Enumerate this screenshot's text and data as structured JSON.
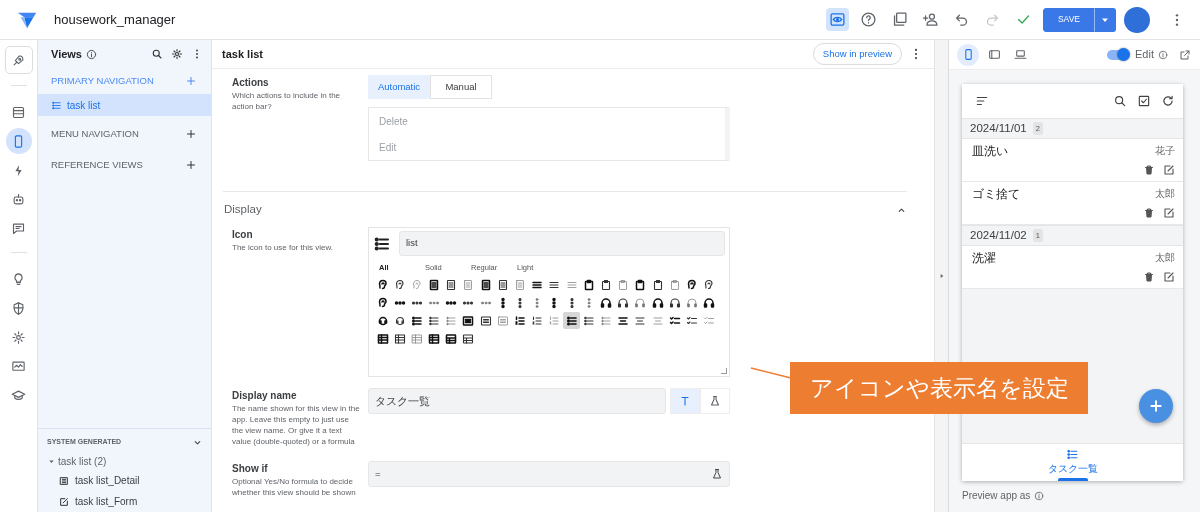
{
  "app": {
    "title": "housework_manager"
  },
  "tools": [
    {
      "selected": true,
      "disabled": false
    },
    {
      "selected": false,
      "disabled": false
    },
    {
      "selected": false,
      "disabled": false
    },
    {
      "selected": false,
      "disabled": false
    },
    {
      "selected": false,
      "disabled": false
    },
    {
      "selected": false,
      "disabled": true
    },
    {
      "selected": false,
      "disabled": false
    }
  ],
  "save_button": {
    "label": "SAVE"
  },
  "rail": [
    {
      "selected": false
    },
    {
      "selected": false
    },
    {
      "selected": true
    },
    {
      "selected": false
    },
    {
      "selected": false
    },
    {
      "selected": false
    },
    {
      "selected": false
    },
    {
      "selected": false
    },
    {
      "selected": false
    },
    {
      "selected": false
    },
    {
      "selected": false
    }
  ],
  "views_panel": {
    "title": "Views",
    "sections": [
      {
        "label": "PRIMARY NAVIGATION",
        "items": [
          {
            "label": "task list",
            "selected": true
          }
        ]
      },
      {
        "label": "MENU NAVIGATION"
      },
      {
        "label": "REFERENCE VIEWS"
      }
    ],
    "system_generated": {
      "label": "SYSTEM GENERATED",
      "expanded": true,
      "groups": [
        {
          "label": "task list (2)",
          "expanded": true,
          "children": [
            {
              "label": "task list_Detail",
              "kind": "detail"
            },
            {
              "label": "task list_Form",
              "kind": "form"
            }
          ]
        }
      ]
    }
  },
  "editor": {
    "title": "task list",
    "preview_button": "Show in preview",
    "actions": {
      "label": "Actions",
      "help": "Which actions to include in the action bar?",
      "modes": [
        {
          "label": "Automatic",
          "selected": true
        },
        {
          "label": "Manual",
          "selected": false
        }
      ],
      "items": [
        "Delete",
        "Edit"
      ]
    },
    "display": {
      "title": "Display",
      "expanded": true,
      "icon": {
        "label": "Icon",
        "help": "The icon to use for this view.",
        "value": "list",
        "filters": [
          {
            "label": "All",
            "selected": true
          },
          {
            "label": "Solid",
            "selected": false
          },
          {
            "label": "Regular",
            "selected": false
          },
          {
            "label": "Light",
            "selected": false
          }
        ],
        "options": [
          {
            "selected": false
          },
          {
            "selected": false
          },
          {
            "selected": false
          },
          {
            "selected": false
          },
          {
            "selected": false
          },
          {
            "selected": false
          },
          {
            "selected": false
          },
          {
            "selected": false
          },
          {
            "selected": false
          },
          {
            "selected": false
          },
          {
            "selected": false
          },
          {
            "selected": false
          },
          {
            "selected": false
          },
          {
            "selected": false
          },
          {
            "selected": false
          },
          {
            "selected": false
          },
          {
            "selected": false
          },
          {
            "selected": false
          },
          {
            "selected": false
          },
          {
            "selected": false
          },
          {
            "selected": false
          },
          {
            "selected": false
          },
          {
            "selected": false
          },
          {
            "selected": false
          },
          {
            "selected": false
          },
          {
            "selected": false
          },
          {
            "selected": false
          },
          {
            "selected": false
          },
          {
            "selected": false
          },
          {
            "selected": false
          },
          {
            "selected": false
          },
          {
            "selected": false
          },
          {
            "selected": false
          },
          {
            "selected": false
          },
          {
            "selected": false
          },
          {
            "selected": false
          },
          {
            "selected": false
          },
          {
            "selected": false
          },
          {
            "selected": false
          },
          {
            "selected": false
          },
          {
            "selected": false
          },
          {
            "selected": false
          },
          {
            "selected": false
          },
          {
            "selected": false
          },
          {
            "selected": false
          },
          {
            "selected": false
          },
          {
            "selected": false
          },
          {
            "selected": false
          },
          {
            "selected": false
          },
          {
            "selected": false
          },
          {
            "selected": false
          },
          {
            "selected": true
          },
          {
            "selected": false
          },
          {
            "selected": false
          },
          {
            "selected": false
          },
          {
            "selected": false
          },
          {
            "selected": false
          },
          {
            "selected": false
          },
          {
            "selected": false
          },
          {
            "selected": false
          },
          {
            "selected": false
          },
          {
            "selected": false
          },
          {
            "selected": false
          },
          {
            "selected": false
          },
          {
            "selected": false
          },
          {
            "selected": false
          }
        ]
      },
      "display_name": {
        "label": "Display name",
        "help": "The name shown for this view in the app. Leave this empty to just use the view name. Or give it a text value (double-quoted) or a formula",
        "value": "タスク一覧",
        "modes": [
          {
            "selected": true
          },
          {
            "selected": false
          }
        ]
      },
      "show_if": {
        "label": "Show if",
        "help": "Optional Yes/No formula to decide whether this view should be shown",
        "value": "="
      }
    }
  },
  "preview": {
    "devices": [
      {
        "selected": true
      },
      {
        "selected": false
      },
      {
        "selected": false
      }
    ],
    "edit_toggle": {
      "label": "Edit",
      "on": true
    },
    "groups": [
      {
        "date": "2024/11/01",
        "count": "2",
        "rows": [
          {
            "task": "皿洗い",
            "person": "花子"
          },
          {
            "task": "ゴミ捨て",
            "person": "太郎"
          }
        ]
      },
      {
        "date": "2024/11/02",
        "count": "1",
        "rows": [
          {
            "task": "洗濯",
            "person": "太郎"
          }
        ]
      }
    ],
    "nav": [
      {
        "label": "タスク一覧",
        "selected": true
      }
    ],
    "footer": "Preview app as"
  },
  "callout": {
    "text": "アイコンや表示名を設定"
  }
}
